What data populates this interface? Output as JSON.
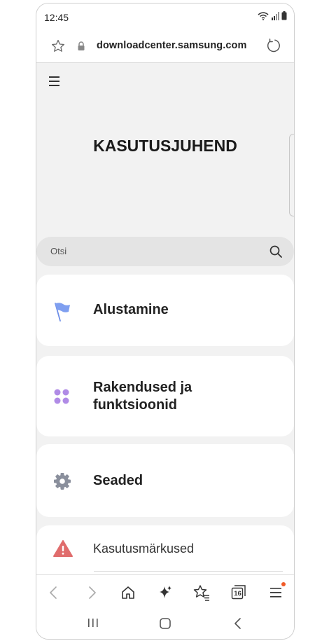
{
  "status": {
    "time": "12:45"
  },
  "browser": {
    "url": "downloadcenter.samsung.com",
    "tab_count": "16"
  },
  "page": {
    "title": "KASUTUSJUHEND"
  },
  "search": {
    "placeholder": "Otsi"
  },
  "cards": [
    {
      "label": "Alustamine",
      "icon": "flag-icon",
      "color": "#6f8fe8"
    },
    {
      "label_line1": "Rakendused ja",
      "label_line2": "funktsioonid",
      "icon": "apps-grid-icon",
      "color": "#b08be6"
    },
    {
      "label": "Seaded",
      "icon": "gear-icon",
      "color": "#8a8f9c"
    },
    {
      "label": "Kasutusmärkused",
      "icon": "warning-icon",
      "color": "#e06d6d"
    }
  ],
  "toolbar": {
    "items": [
      "back-icon",
      "forward-icon",
      "home-icon",
      "sparkle-icon",
      "bookmarks-icon",
      "tabs-icon",
      "menu-icon"
    ]
  },
  "colors": {
    "notification_dot": "#f05a28",
    "background": "#f2f2f2"
  }
}
